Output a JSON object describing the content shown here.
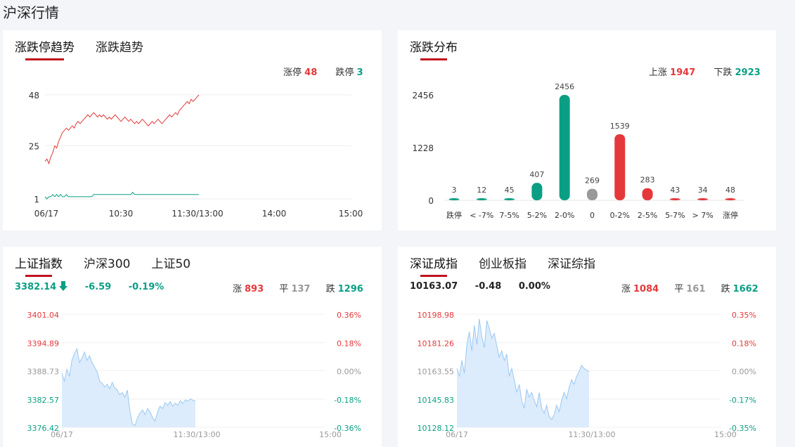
{
  "page_title": "沪深行情",
  "p1": {
    "tabs": [
      "涨跌停趋势",
      "涨跌趋势"
    ],
    "legend": {
      "up_label": "涨停",
      "up_value": "48",
      "down_label": "跌停",
      "down_value": "3"
    }
  },
  "p2": {
    "tabs": [
      "涨跌分布"
    ],
    "legend": {
      "up_label": "上涨",
      "up_value": "1947",
      "down_label": "下跌",
      "down_value": "2923"
    }
  },
  "p3": {
    "tabs": [
      "上证指数",
      "沪深300",
      "上证50"
    ],
    "quote": {
      "price": "3382.14",
      "change": "-6.59",
      "pct": "-0.19%"
    },
    "stats": {
      "up_label": "涨",
      "up": "893",
      "flat_label": "平",
      "flat": "137",
      "down_label": "跌",
      "down": "1296"
    }
  },
  "p4": {
    "tabs": [
      "深证成指",
      "创业板指",
      "深证综指"
    ],
    "quote": {
      "price": "10163.07",
      "change": "-0.48",
      "pct": "0.00%"
    },
    "stats": {
      "up_label": "涨",
      "up": "1084",
      "flat_label": "平",
      "flat": "161",
      "down_label": "跌",
      "down": "1662"
    }
  },
  "colors": {
    "up": "#e5383b",
    "down": "#0a9f84",
    "flat": "#999999",
    "area_fill": "#dcecfc",
    "area_line": "#9cc8f2",
    "accent": "#c1121f"
  },
  "chart_data": [
    {
      "id": "limit-trend",
      "type": "line",
      "x_ticks": [
        "06/17",
        "10:30",
        "11:30/13:00",
        "14:00",
        "15:00"
      ],
      "y_ticks": [
        "48",
        "25",
        "1"
      ],
      "ylim": [
        1,
        48
      ],
      "series": [
        {
          "name": "涨停",
          "color": "#e5383b",
          "values": [
            18,
            19,
            17,
            20,
            22,
            25,
            24,
            27,
            29,
            31,
            32,
            33,
            32,
            33,
            34,
            33,
            35,
            36,
            35,
            36,
            37,
            38,
            39,
            38,
            39,
            40,
            39,
            38,
            39,
            38,
            39,
            38,
            37,
            38,
            37,
            38,
            39,
            38,
            37,
            36,
            37,
            38,
            37,
            36,
            37,
            36,
            35,
            36,
            35,
            36,
            37,
            36,
            35,
            34,
            35,
            36,
            35,
            36,
            37,
            36,
            35,
            36,
            37,
            38,
            39,
            38,
            39,
            40,
            39,
            41,
            42,
            43,
            44,
            45,
            44,
            46,
            45,
            46,
            47,
            48
          ]
        },
        {
          "name": "跌停",
          "color": "#0a9f84",
          "values": [
            2,
            1,
            2,
            2,
            3,
            2,
            3,
            2,
            3,
            2,
            2,
            3,
            2,
            2,
            2,
            2,
            2,
            2,
            2,
            2,
            2,
            2,
            2,
            2,
            2,
            3,
            3,
            3,
            3,
            3,
            3,
            3,
            3,
            3,
            3,
            3,
            3,
            3,
            3,
            3,
            3,
            3,
            3,
            3,
            3,
            4,
            3,
            3,
            3,
            3,
            3,
            3,
            3,
            3,
            3,
            3,
            3,
            3,
            3,
            3,
            3,
            3,
            3,
            3,
            3,
            3,
            3,
            3,
            3,
            3,
            3,
            3,
            3,
            3,
            3,
            3,
            3,
            3,
            3,
            3
          ]
        }
      ]
    },
    {
      "id": "distribution",
      "type": "bar",
      "categories": [
        "跌停",
        "< -7%",
        "7-5%",
        "5-2%",
        "2-0%",
        "0",
        "0-2%",
        "2-5%",
        "5-7%",
        "> 7%",
        "涨停"
      ],
      "values": [
        3,
        12,
        45,
        407,
        2456,
        269,
        1539,
        283,
        43,
        34,
        48
      ],
      "colors": [
        "#0a9f84",
        "#0a9f84",
        "#0a9f84",
        "#0a9f84",
        "#0a9f84",
        "#999999",
        "#e5383b",
        "#e5383b",
        "#e5383b",
        "#e5383b",
        "#e5383b"
      ],
      "y_ticks": [
        "2456",
        "1228",
        "0"
      ],
      "ylim": [
        0,
        2456
      ]
    },
    {
      "id": "sh-index",
      "type": "area",
      "x_ticks": [
        "06/17",
        "11:30/13:00",
        "15:00"
      ],
      "y_ticks": [
        "3401.04",
        "3394.89",
        "3388.73",
        "3382.57",
        "3376.42"
      ],
      "pct_ticks": [
        "0.36%",
        "0.18%",
        "0.00%",
        "-0.18%",
        "-0.36%"
      ],
      "ylim": [
        3376.42,
        3401.04
      ],
      "values": [
        3388.2,
        3386.5,
        3389.0,
        3387.5,
        3391.0,
        3392.5,
        3393.5,
        3390.5,
        3391.5,
        3392.8,
        3391.0,
        3392.0,
        3390.5,
        3389.5,
        3388.5,
        3386.5,
        3386.0,
        3385.2,
        3385.8,
        3384.8,
        3386.2,
        3385.0,
        3384.5,
        3383.5,
        3384.0,
        3383.0,
        3384.5,
        3380.0,
        3377.2,
        3376.8,
        3378.5,
        3379.5,
        3380.2,
        3379.2,
        3380.5,
        3379.8,
        3378.5,
        3377.8,
        3379.8,
        3381.0,
        3380.5,
        3381.8,
        3381.2,
        3382.0,
        3381.0,
        3381.7,
        3381.2,
        3382.2,
        3381.6,
        3382.4,
        3382.1,
        3382.6,
        3382.3,
        3382.14
      ]
    },
    {
      "id": "sz-index",
      "type": "area",
      "x_ticks": [
        "06/17",
        "11:30/13:00",
        "15:00"
      ],
      "y_ticks": [
        "10198.98",
        "10181.26",
        "10163.55",
        "10145.83",
        "10128.12"
      ],
      "pct_ticks": [
        "0.35%",
        "0.18%",
        "0.00%",
        "-0.17%",
        "-0.35%"
      ],
      "ylim": [
        10128.12,
        10198.98
      ],
      "values": [
        10165,
        10160,
        10170,
        10162,
        10180,
        10188,
        10176,
        10192,
        10180,
        10196,
        10185,
        10178,
        10195,
        10190,
        10184,
        10187,
        10179,
        10172,
        10176,
        10170,
        10174,
        10160,
        10165,
        10158,
        10150,
        10155,
        10145,
        10140,
        10152,
        10147,
        10150,
        10145,
        10141,
        10150,
        10140,
        10137,
        10142,
        10135,
        10133,
        10136,
        10142,
        10138,
        10145,
        10150,
        10146,
        10153,
        10158,
        10155,
        10160,
        10163,
        10167,
        10165,
        10164,
        10163.07
      ]
    }
  ]
}
